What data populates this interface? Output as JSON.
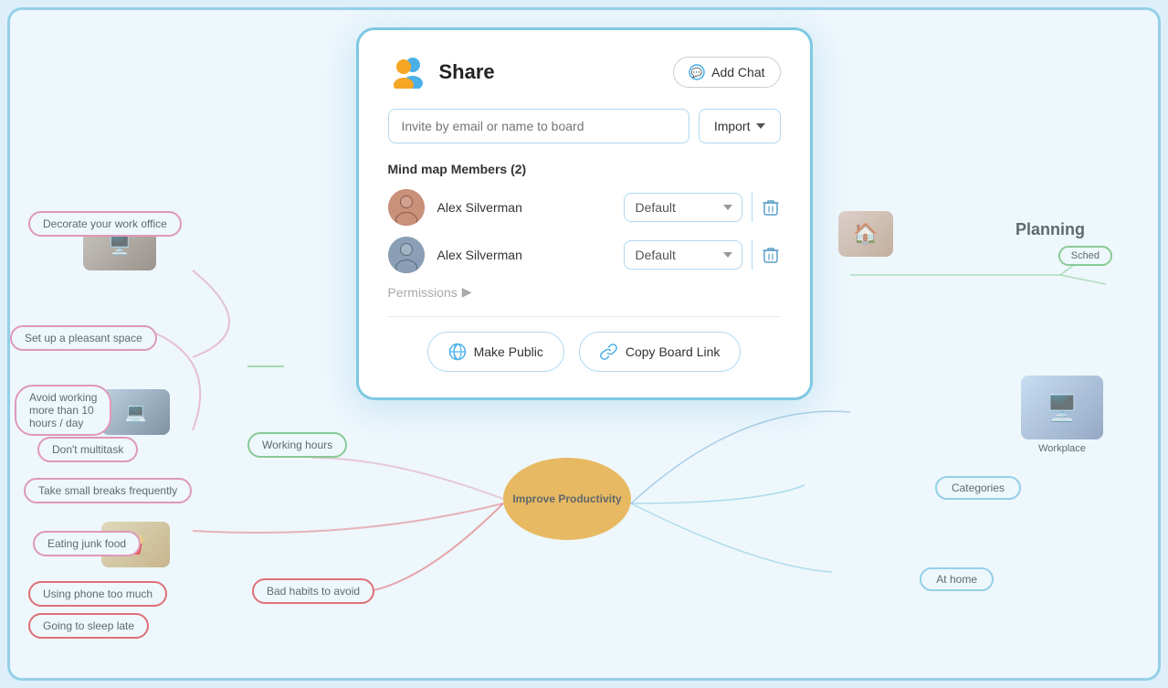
{
  "modal": {
    "title": "Share",
    "add_chat_label": "Add Chat",
    "invite_placeholder": "Invite by email or name to board",
    "import_label": "Import",
    "members_heading": "Mind map Members (2)",
    "members": [
      {
        "name": "Alex Silverman",
        "role": "Default",
        "avatar_type": "female"
      },
      {
        "name": "Alex Silverman",
        "role": "Default",
        "avatar_type": "male"
      }
    ],
    "permissions_label": "Permissions",
    "make_public_label": "Make Public",
    "copy_board_link_label": "Copy Board Link"
  },
  "mindmap": {
    "center_label": "Improve Productivity",
    "left_nodes": [
      {
        "label": "Decorate your work office",
        "style": "pink"
      },
      {
        "label": "Set up a pleasant space",
        "style": "pink"
      },
      {
        "label": "Avoid working more than 10 hours / day",
        "style": "pink"
      },
      {
        "label": "Don't multitask",
        "style": "pink"
      },
      {
        "label": "Take small breaks frequently",
        "style": "pink"
      },
      {
        "label": "Eating junk food",
        "style": "red"
      },
      {
        "label": "Using phone too much",
        "style": "red"
      },
      {
        "label": "Going to sleep late",
        "style": "red"
      }
    ],
    "right_nodes": [
      {
        "label": "Planning",
        "style": "bold"
      },
      {
        "label": "Categories",
        "style": "blue"
      },
      {
        "label": "At home",
        "style": "blue"
      },
      {
        "label": "Workplace",
        "style": "text"
      },
      {
        "label": "Sched",
        "style": "green"
      }
    ],
    "middle_nodes": [
      {
        "label": "Working hours",
        "style": "green"
      },
      {
        "label": "Bad habits to avoid",
        "style": "red"
      }
    ]
  }
}
